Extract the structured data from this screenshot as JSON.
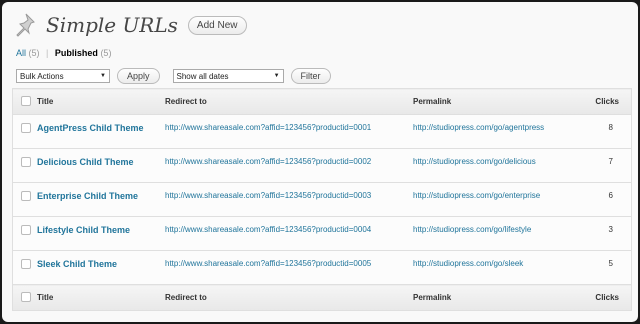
{
  "header": {
    "title": "Simple URLs",
    "add_new_label": "Add New",
    "icon": "pushpin-icon"
  },
  "filters": {
    "all_label": "All",
    "all_count": "(5)",
    "separator": "|",
    "published_label": "Published",
    "published_count": "(5)"
  },
  "actions": {
    "bulk_select": "Bulk Actions",
    "apply_label": "Apply",
    "dates_select": "Show all dates",
    "filter_label": "Filter"
  },
  "table": {
    "columns": {
      "title": "Title",
      "redirect": "Redirect to",
      "permalink": "Permalink",
      "clicks": "Clicks"
    },
    "rows": [
      {
        "title": "AgentPress Child Theme",
        "redirect": "http://www.shareasale.com?affid=123456?productid=0001",
        "permalink": "http://studiopress.com/go/agentpress",
        "clicks": "8"
      },
      {
        "title": "Delicious Child Theme",
        "redirect": "http://www.shareasale.com?affid=123456?productid=0002",
        "permalink": "http://studiopress.com/go/delicious",
        "clicks": "7"
      },
      {
        "title": "Enterprise Child Theme",
        "redirect": "http://www.shareasale.com?affid=123456?productid=0003",
        "permalink": "http://studiopress.com/go/enterprise",
        "clicks": "6"
      },
      {
        "title": "Lifestyle Child Theme",
        "redirect": "http://www.shareasale.com?affid=123456?productid=0004",
        "permalink": "http://studiopress.com/go/lifestyle",
        "clicks": "3"
      },
      {
        "title": "Sleek Child Theme",
        "redirect": "http://www.shareasale.com?affid=123456?productid=0005",
        "permalink": "http://studiopress.com/go/sleek",
        "clicks": "5"
      }
    ]
  },
  "colors": {
    "link": "#21759b",
    "background": "#f9f9f9",
    "outer": "#1a1a1a"
  }
}
